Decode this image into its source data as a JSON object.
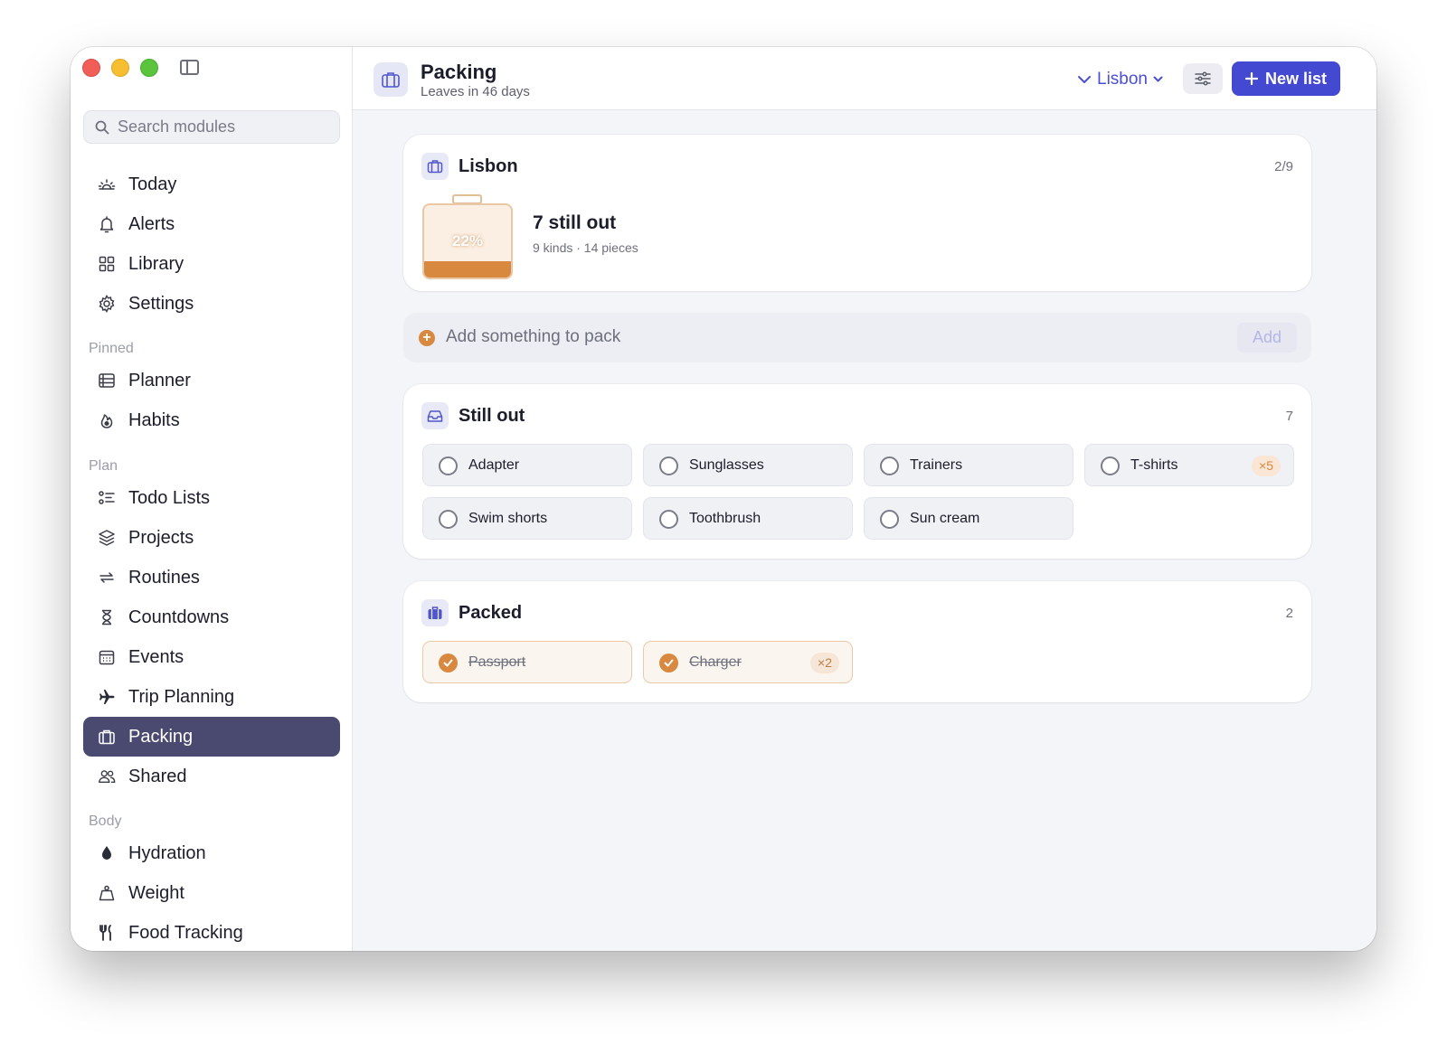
{
  "sidebar": {
    "search_placeholder": "Search modules",
    "main_items": [
      {
        "label": "Today",
        "icon": "sunrise-icon"
      },
      {
        "label": "Alerts",
        "icon": "bell-icon"
      },
      {
        "label": "Library",
        "icon": "grid-icon"
      },
      {
        "label": "Settings",
        "icon": "gear-icon"
      }
    ],
    "sections": [
      {
        "label": "Pinned",
        "items": [
          {
            "label": "Planner",
            "icon": "planner-icon"
          },
          {
            "label": "Habits",
            "icon": "flame-icon"
          }
        ]
      },
      {
        "label": "Plan",
        "items": [
          {
            "label": "Todo Lists",
            "icon": "checklist-icon"
          },
          {
            "label": "Projects",
            "icon": "layers-icon"
          },
          {
            "label": "Routines",
            "icon": "repeat-icon"
          },
          {
            "label": "Countdowns",
            "icon": "hourglass-icon"
          },
          {
            "label": "Events",
            "icon": "calendar-icon"
          },
          {
            "label": "Trip Planning",
            "icon": "airplane-icon"
          },
          {
            "label": "Packing",
            "icon": "suitcase-icon",
            "active": true
          },
          {
            "label": "Shared",
            "icon": "people-icon"
          }
        ]
      },
      {
        "label": "Body",
        "items": [
          {
            "label": "Hydration",
            "icon": "drop-icon"
          },
          {
            "label": "Weight",
            "icon": "weight-icon"
          },
          {
            "label": "Food Tracking",
            "icon": "fork-knife-icon"
          }
        ]
      }
    ]
  },
  "header": {
    "title": "Packing",
    "subtitle": "Leaves in 46 days",
    "list_selector": "Lisbon",
    "new_button": "New list"
  },
  "summary": {
    "title": "Lisbon",
    "count": "2/9",
    "percent_label": "22%",
    "percent_value": 0.22,
    "headline": "7 still out",
    "detail": "9 kinds · 14 pieces"
  },
  "add": {
    "placeholder": "Add something to pack",
    "button": "Add"
  },
  "still_out": {
    "title": "Still out",
    "count": "7",
    "items": [
      {
        "label": "Adapter"
      },
      {
        "label": "Sunglasses"
      },
      {
        "label": "Trainers"
      },
      {
        "label": "T-shirts",
        "qty": "×5"
      },
      {
        "label": "Swim shorts"
      },
      {
        "label": "Toothbrush"
      },
      {
        "label": "Sun cream"
      }
    ]
  },
  "packed": {
    "title": "Packed",
    "count": "2",
    "items": [
      {
        "label": "Passport"
      },
      {
        "label": "Charger",
        "qty": "×2"
      }
    ]
  },
  "colors": {
    "accent": "#4449d2",
    "sidebar_active": "#4a4a70",
    "packing_orange": "#d8883f"
  }
}
